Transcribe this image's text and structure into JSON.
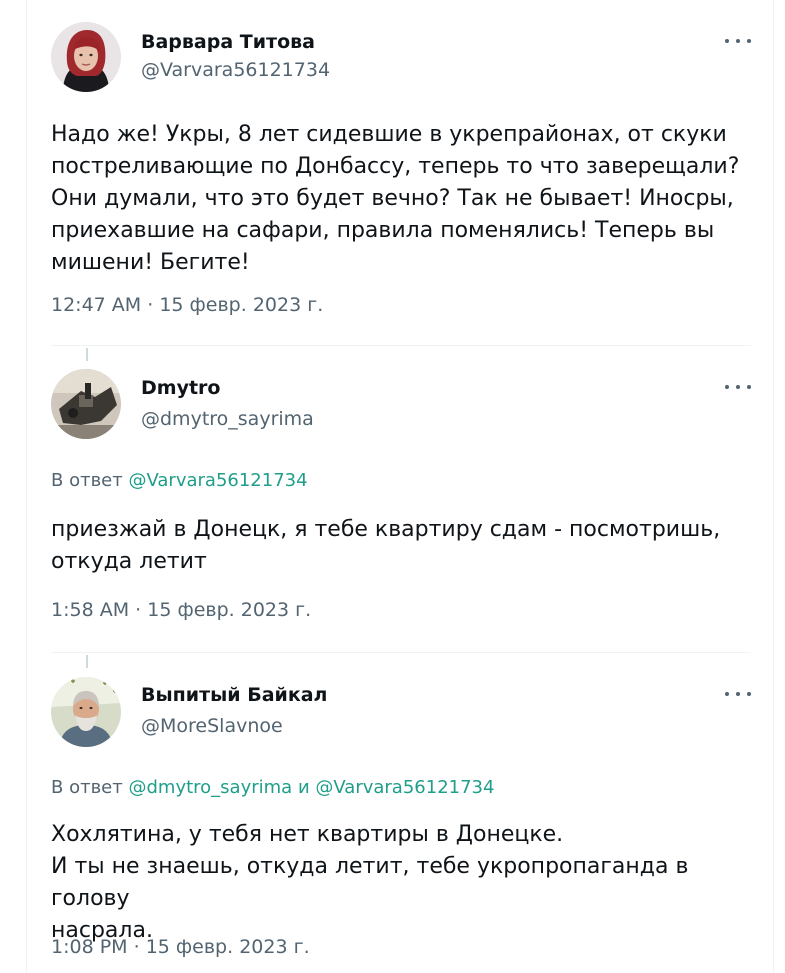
{
  "tweets": [
    {
      "name": "Варвара Титова",
      "handle": "@Varvara56121734",
      "text": "Надо же! Укры, 8 лет сидевшие в укрепрайонах, от скуки\nпостреливающие по Донбассу, теперь то что заверещали?\nОни думали, что это будет вечно? Так не бывает! Иносры,\nприехавшие на сафари, правила поменялись! Теперь вы\nмишени! Бегите!",
      "time": "12:47 AM",
      "date": "15 февр. 2023 г."
    },
    {
      "name": "Dmytro",
      "handle": "@dmytro_sayrima",
      "reply_prefix": "В ответ",
      "reply_to_1": "@Varvara56121734",
      "text": "приезжай в Донецк, я тебе квартиру сдам - посмотришь,\nоткуда летит",
      "time": "1:58 AM",
      "date": "15 февр. 2023 г."
    },
    {
      "name": "Выпитый Байкал",
      "handle": "@MoreSlavnoe",
      "reply_prefix": "В ответ",
      "reply_to_1": "@dmytro_sayrima",
      "reply_joiner": "и",
      "reply_to_2": "@Varvara56121734",
      "text": "Хохлятина, у тебя нет квартиры в Донецке.\nИ ты не знаешь, откуда летит, тебе укропропаганда в голову\nнасрала.",
      "time": "1:08 PM",
      "date": "15 февр. 2023 г."
    }
  ],
  "meta_separator": "·",
  "icons": {
    "more": "more-horizontal-icon",
    "avatar_1": "avatar-woman",
    "avatar_2": "avatar-dmytro",
    "avatar_3": "avatar-bearded-man"
  },
  "colors": {
    "link": "#1f9e8a",
    "secondary": "#536471",
    "text": "#0f1419"
  }
}
